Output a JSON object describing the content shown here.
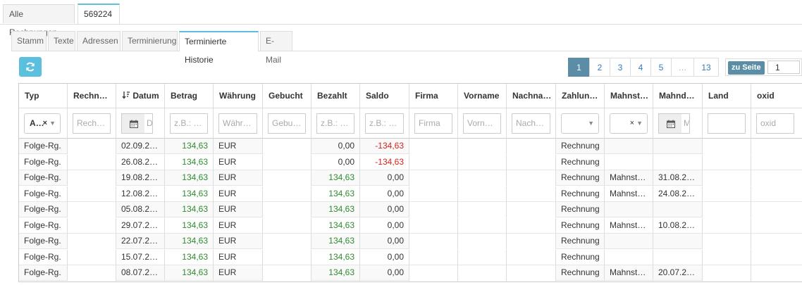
{
  "top_tabs": [
    {
      "label": "Alle Rechnungen"
    },
    {
      "label": "569224"
    }
  ],
  "sub_tabs": [
    {
      "label": "Stamm"
    },
    {
      "label": "Texte"
    },
    {
      "label": "Adressen"
    },
    {
      "label": "Terminierung"
    },
    {
      "label": "Terminierte Historie"
    },
    {
      "label": "E-Mail"
    }
  ],
  "toolbar": {
    "refresh_icon": "refresh-icon"
  },
  "pager": {
    "pages": [
      "1",
      "2",
      "3",
      "4",
      "5",
      "…",
      "13"
    ],
    "active_page": "1",
    "goto_label": "zu Seite",
    "goto_value": "1"
  },
  "columns": [
    "Typ",
    "Rechn…",
    "Datum",
    "Betrag",
    "Währung",
    "Gebucht",
    "Bezahlt",
    "Saldo",
    "Firma",
    "Vorname",
    "Nachna…",
    "Zahlun…",
    "Mahnst…",
    "Mahnd…",
    "Land",
    "oxid"
  ],
  "sort_icon": "sort-desc-icon",
  "filters": {
    "typ": "A…",
    "rechnung": "Rech…",
    "datum": "D",
    "betrag": "z.B.: …",
    "waehrung": "Währ…",
    "gebucht": "Gebu…",
    "bezahlt": "z.B.: …",
    "saldo": "z.B.: …",
    "firma": "Firma",
    "vorname": "Vorn…",
    "nachname": "Nach…",
    "zahlung": "",
    "mahnstufe": "",
    "mahndatum": "M",
    "land": "",
    "oxid": "oxid"
  },
  "rows": [
    {
      "typ": "Folge-Rg.",
      "datum": "02.09.2…",
      "betrag": "134,63",
      "waehrung": "EUR",
      "bezahlt": "0,00",
      "saldo": "-134,63",
      "zahlung": "Rechnung",
      "mahnstufe": "",
      "mahndatum": ""
    },
    {
      "typ": "Folge-Rg.",
      "datum": "26.08.2…",
      "betrag": "134,63",
      "waehrung": "EUR",
      "bezahlt": "0,00",
      "saldo": "-134,63",
      "zahlung": "Rechnung",
      "mahnstufe": "",
      "mahndatum": ""
    },
    {
      "typ": "Folge-Rg.",
      "datum": "19.08.2…",
      "betrag": "134,63",
      "waehrung": "EUR",
      "bezahlt": "134,63",
      "saldo": "0,00",
      "zahlung": "Rechnung",
      "mahnstufe": "Mahnst…",
      "mahndatum": "31.08.2…"
    },
    {
      "typ": "Folge-Rg.",
      "datum": "12.08.2…",
      "betrag": "134,63",
      "waehrung": "EUR",
      "bezahlt": "134,63",
      "saldo": "0,00",
      "zahlung": "Rechnung",
      "mahnstufe": "Mahnst…",
      "mahndatum": "24.08.2…"
    },
    {
      "typ": "Folge-Rg.",
      "datum": "05.08.2…",
      "betrag": "134,63",
      "waehrung": "EUR",
      "bezahlt": "134,63",
      "saldo": "0,00",
      "zahlung": "Rechnung",
      "mahnstufe": "",
      "mahndatum": ""
    },
    {
      "typ": "Folge-Rg.",
      "datum": "29.07.2…",
      "betrag": "134,63",
      "waehrung": "EUR",
      "bezahlt": "134,63",
      "saldo": "0,00",
      "zahlung": "Rechnung",
      "mahnstufe": "Mahnst…",
      "mahndatum": "10.08.2…"
    },
    {
      "typ": "Folge-Rg.",
      "datum": "22.07.2…",
      "betrag": "134,63",
      "waehrung": "EUR",
      "bezahlt": "134,63",
      "saldo": "0,00",
      "zahlung": "Rechnung",
      "mahnstufe": "",
      "mahndatum": ""
    },
    {
      "typ": "Folge-Rg.",
      "datum": "15.07.2…",
      "betrag": "134,63",
      "waehrung": "EUR",
      "bezahlt": "134,63",
      "saldo": "0,00",
      "zahlung": "Rechnung",
      "mahnstufe": "",
      "mahndatum": ""
    },
    {
      "typ": "Folge-Rg.",
      "datum": "08.07.2…",
      "betrag": "134,63",
      "waehrung": "EUR",
      "bezahlt": "134,63",
      "saldo": "0,00",
      "zahlung": "Rechnung",
      "mahnstufe": "Mahnst…",
      "mahndatum": "20.07.2…"
    }
  ],
  "colors": {
    "accent": "#5bc0de",
    "pager_active": "#5b8ea6",
    "positive": "#2e8b2e",
    "negative": "#d9221c"
  }
}
